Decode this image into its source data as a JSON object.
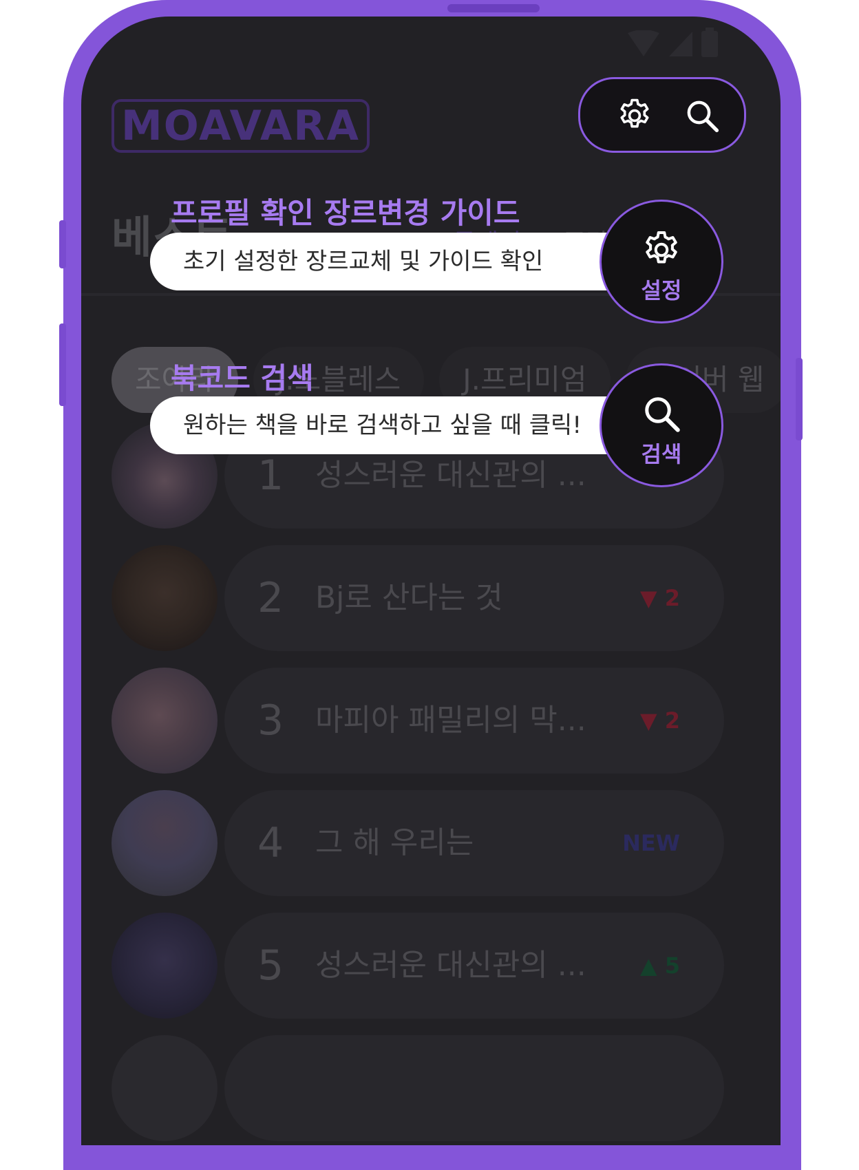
{
  "app": {
    "logo": "MOAVARA",
    "page_title": "베스트",
    "tabs": [
      "투데이",
      "주간"
    ]
  },
  "chips": [
    "조아라",
    "J.노블레스",
    "J.프리미엄",
    "네이버 웹"
  ],
  "ranking": [
    {
      "rank": "1",
      "title": "성스러운 대신관의 ...",
      "badge": "",
      "badge_color": "#6a6a6a"
    },
    {
      "rank": "2",
      "title": "Bj로 산다는 것",
      "badge": "▼ 2",
      "badge_color": "#6b1c2a"
    },
    {
      "rank": "3",
      "title": "마피아 패밀리의 막...",
      "badge": "▼ 2",
      "badge_color": "#6b1c2a"
    },
    {
      "rank": "4",
      "title": "그 해 우리는",
      "badge": "NEW",
      "badge_color": "#2b2a5e"
    },
    {
      "rank": "5",
      "title": "성스러운 대신관의 ...",
      "badge": "▲ 5",
      "badge_color": "#14412c"
    }
  ],
  "toolbar": {
    "settings_icon": "gear-icon",
    "search_icon": "search-icon"
  },
  "guide": {
    "settings": {
      "title": "프로필 확인 장르변경 가이드",
      "description": "초기 설정한 장르교체 및 가이드 확인",
      "button_label": "설정"
    },
    "search": {
      "title": "북코드 검색",
      "description": "원하는 책을 바로 검색하고 싶을 때 클릭!",
      "button_label": "검색"
    }
  },
  "colors": {
    "accent": "#8455d9",
    "accent_text": "#a77bf0",
    "screen_bg": "#222125"
  }
}
